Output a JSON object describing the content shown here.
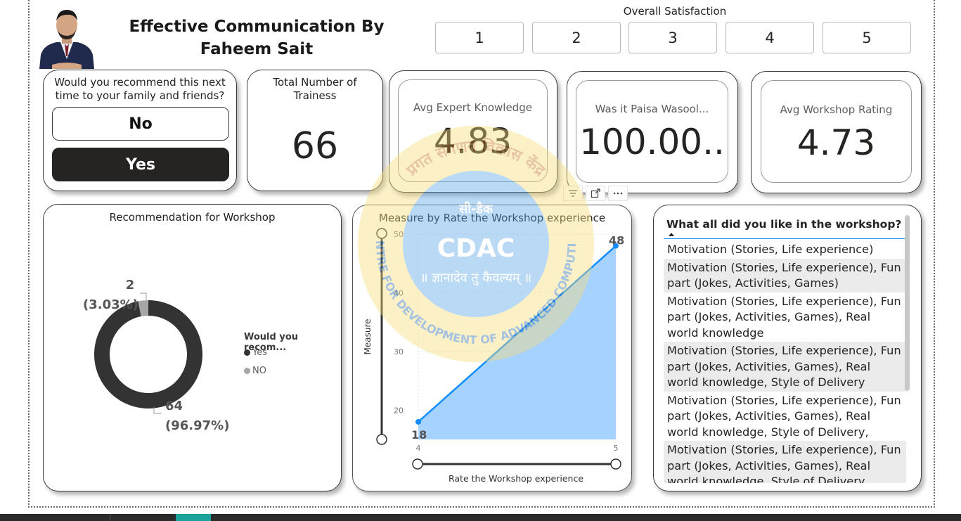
{
  "report": {
    "title": "Effective Communication By Faheem Sait"
  },
  "satisfaction_slicer": {
    "title": "Overall Satisfaction",
    "options": [
      "1",
      "2",
      "3",
      "4",
      "5"
    ]
  },
  "recommend_slicer": {
    "question": "Would you recommend this next time to your family and friends?",
    "options": [
      "No",
      "Yes"
    ],
    "selected": "Yes"
  },
  "kpis": {
    "trainees": {
      "label": "Total Number of Trainess",
      "value": "66"
    },
    "expert_knowledge": {
      "label": "Avg Expert Knowledge",
      "value": "4.83"
    },
    "paisa_wasool": {
      "label": "Was it Paisa Wasool...",
      "value": "100.00.."
    },
    "workshop_rating": {
      "label": "Avg Workshop Rating",
      "value": "4.73"
    }
  },
  "donut": {
    "title": "Recommendation for Workshop",
    "legend_title": "Would you recom...",
    "colors": {
      "Yes": "#333333",
      "NO": "#a6a6a6"
    }
  },
  "line_visual": {
    "header_icons": [
      "filter-icon",
      "focus-mode-icon",
      "more-options-icon"
    ],
    "title": "Measure by Rate the Workshop experience"
  },
  "chart_data": [
    {
      "type": "pie",
      "title": "Recommendation for Workshop",
      "legend_title": "Would you recom...",
      "legend_position": "right",
      "categories": [
        "Yes",
        "NO"
      ],
      "values": [
        64,
        2
      ],
      "labels": [
        "64",
        "(96.97%)",
        "2",
        "(3.03%)"
      ],
      "colors": [
        "#333333",
        "#a6a6a6"
      ],
      "donut": true
    },
    {
      "type": "area",
      "title": "Measure by Rate the Workshop experience",
      "xlabel": "Rate the Workshop experience",
      "ylabel": "Measure",
      "x": [
        4,
        5
      ],
      "values": [
        18,
        48
      ],
      "data_labels": [
        "18",
        "48"
      ],
      "x_ticks": [
        "4",
        "5"
      ],
      "y_ticks": [
        "20",
        "30",
        "40",
        "50"
      ],
      "ylim": [
        15,
        50
      ],
      "grid": true,
      "colors": {
        "line": "#118dff",
        "fill": "#a5d2ff"
      }
    }
  ],
  "liked_list": {
    "header": "What all did you like in the workshop?",
    "items": [
      "Motivation (Stories, Life experience)",
      "Motivation (Stories, Life experience), Fun part (Jokes, Activities, Games)",
      "Motivation (Stories, Life experience), Fun part (Jokes, Activities, Games), Real world knowledge",
      "Motivation (Stories, Life experience), Fun part (Jokes, Activities, Games), Real world knowledge, Style of Delivery",
      "Motivation (Stories, Life experience), Fun part (Jokes, Activities, Games), Real world knowledge, Style of Delivery,",
      "Motivation (Stories, Life experience), Fun part (Jokes, Activities, Games), Real world knowledge, Style of Delivery, Explanation"
    ]
  },
  "watermark": {
    "brand": "CDAC",
    "tagline": "॥ ज्ञानादेव तु कैवल्यम् ॥",
    "ring_text": "CENTRE FOR DEVELOPMENT OF ADVANCED COMPUTING",
    "top_text": "प्रगत संगणन विकास केंद्र",
    "mark": "सी-डैक"
  }
}
